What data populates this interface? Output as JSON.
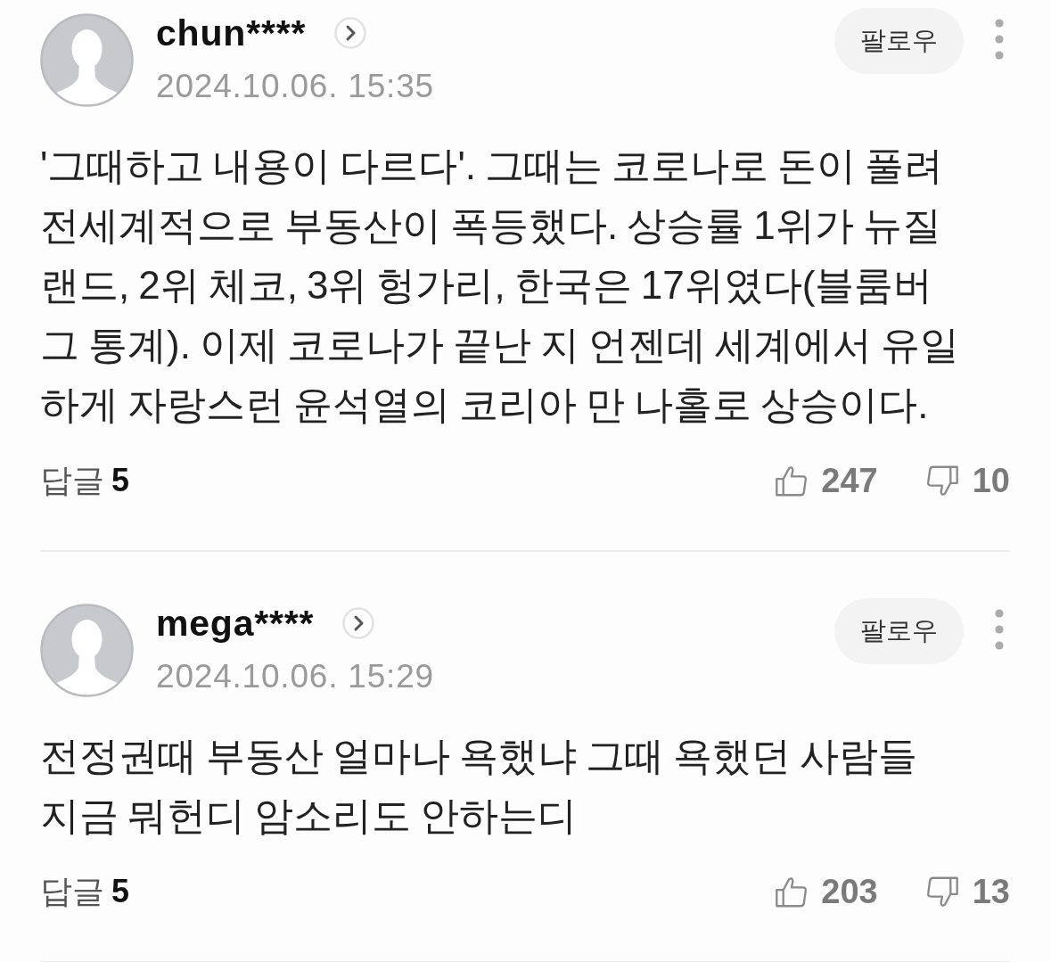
{
  "comments": [
    {
      "username": "chun****",
      "date": "2024.10.06. 15:35",
      "follow_label": "팔로우",
      "body": "'그때하고 내용이 다르다'. 그때는 코로나로 돈이 풀려 전세계적으로 부동산이 폭등했다. 상승률 1위가 뉴질랜드, 2위 체코, 3위 헝가리, 한국은 17위였다(블룸버그 통계). 이제 코로나가 끝난 지 언젠데 세계에서 유일하게 자랑스런 윤석열의 코리아 만 나홀로 상승이다.",
      "reply_label": "답글",
      "reply_count": "5",
      "likes": "247",
      "dislikes": "10"
    },
    {
      "username": "mega****",
      "date": "2024.10.06. 15:29",
      "follow_label": "팔로우",
      "body": "전정권때 부동산 얼마나 욕했냐 그때 욕했던 사람들 지금 뭐헌디 암소리도 안하는디",
      "reply_label": "답글",
      "reply_count": "5",
      "likes": "203",
      "dislikes": "13"
    }
  ]
}
